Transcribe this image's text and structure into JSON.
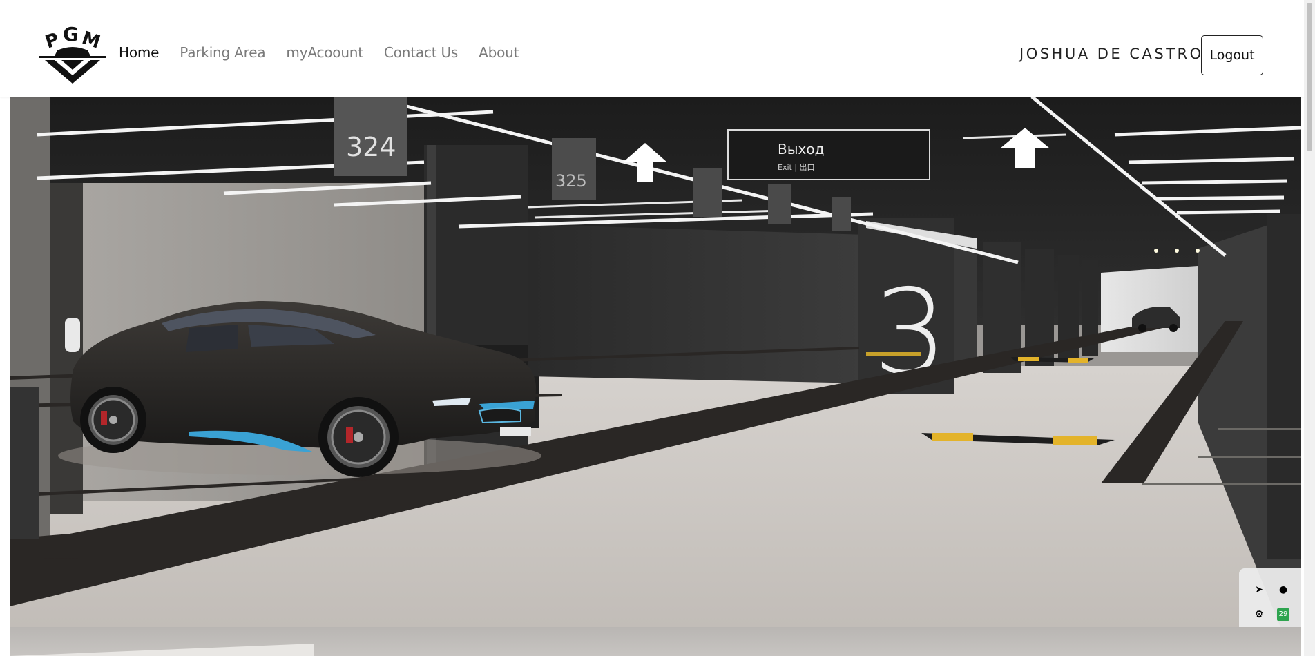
{
  "nav": {
    "brand_alt": "PGM",
    "links": [
      {
        "label": "Home",
        "active": true
      },
      {
        "label": "Parking Area",
        "active": false
      },
      {
        "label": "myAcoount",
        "active": false
      },
      {
        "label": "Contact Us",
        "active": false
      },
      {
        "label": "About",
        "active": false
      }
    ],
    "user_name": "JOSHUA DE CASTRO",
    "logout_label": "Logout"
  },
  "hero": {
    "sign_main": "Выход",
    "sign_sub": "Exit | 出口",
    "spot_1": "324",
    "spot_2": "325",
    "level_number": "3"
  },
  "widget": {
    "badge": "29"
  },
  "colors": {
    "nav_active": "#111111",
    "nav_inactive": "#7a7a7a",
    "floor": "#cfcac5",
    "stripe": "#2a2725",
    "speed_bump_yellow": "#e3b32a"
  }
}
